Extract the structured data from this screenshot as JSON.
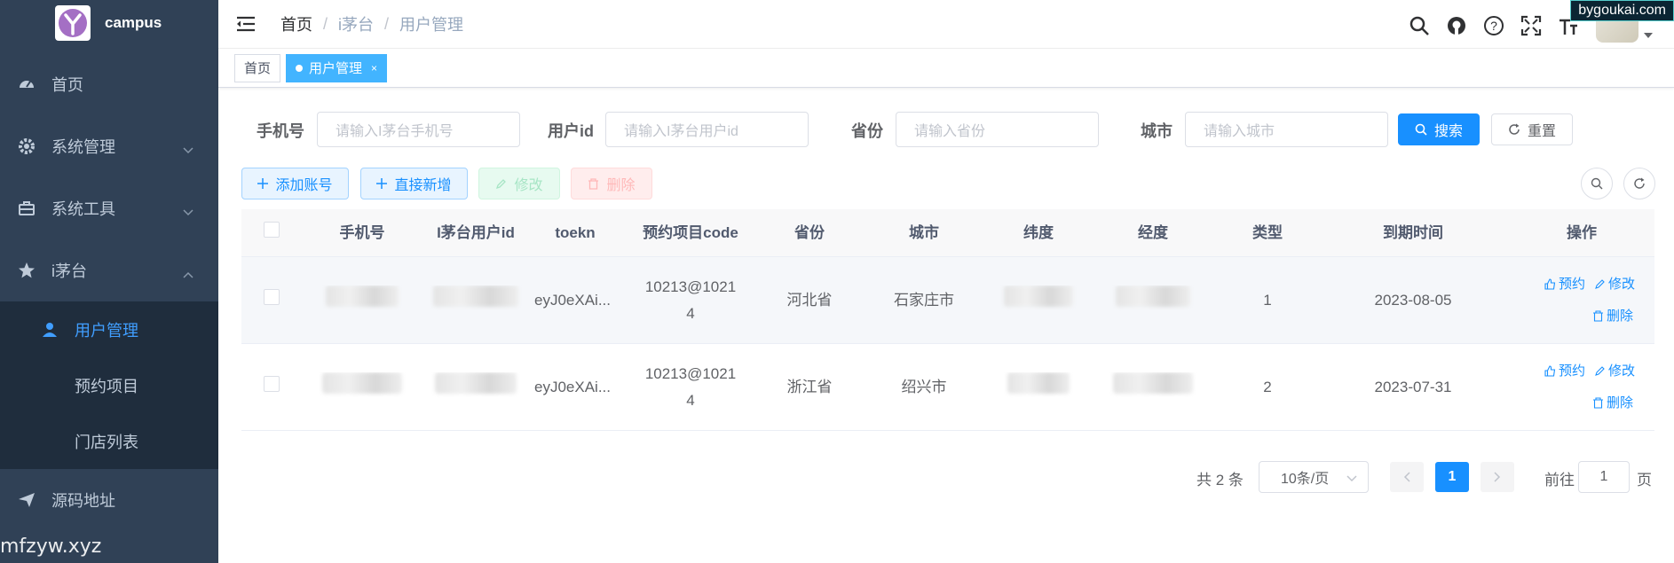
{
  "app": {
    "name": "campus"
  },
  "sidebar": {
    "items": [
      {
        "label": "首页",
        "icon": "dashboard-icon"
      },
      {
        "label": "系统管理",
        "icon": "gear-icon"
      },
      {
        "label": "系统工具",
        "icon": "toolbox-icon"
      },
      {
        "label": "i茅台",
        "icon": "star-icon"
      }
    ],
    "submenu": [
      {
        "label": "用户管理",
        "icon": "user-icon",
        "active": true
      },
      {
        "label": "预约项目"
      },
      {
        "label": "门店列表"
      }
    ],
    "bottom_item": {
      "label": "源码地址",
      "icon": "send-icon"
    }
  },
  "navbar": {
    "breadcrumb": [
      "首页",
      "i茅台",
      "用户管理"
    ],
    "watermark": "bygoukai.com"
  },
  "tags": [
    {
      "label": "首页",
      "active": false
    },
    {
      "label": "用户管理",
      "active": true,
      "close": "×"
    }
  ],
  "search": {
    "phone_label": "手机号",
    "phone_placeholder": "请输入I茅台手机号",
    "userid_label": "用户id",
    "userid_placeholder": "请输入I茅台用户id",
    "province_label": "省份",
    "province_placeholder": "请输入省份",
    "city_label": "城市",
    "city_placeholder": "请输入城市",
    "search_button": "搜索",
    "reset_button": "重置"
  },
  "toolbar": {
    "add_account": "添加账号",
    "direct_add": "直接新增",
    "edit": "修改",
    "delete": "删除"
  },
  "table": {
    "columns": [
      "手机号",
      "I茅台用户id",
      "toekn",
      "预约项目code",
      "省份",
      "城市",
      "纬度",
      "经度",
      "类型",
      "到期时间",
      "操作"
    ],
    "rows": [
      {
        "token": "eyJ0eXAi...",
        "code_l1": "10213@1021",
        "code_l2": "4",
        "province": "河北省",
        "city": "石家庄市",
        "type": "1",
        "expire": "2023-08-05"
      },
      {
        "token": "eyJ0eXAi...",
        "code_l1": "10213@1021",
        "code_l2": "4",
        "province": "浙江省",
        "city": "绍兴市",
        "type": "2",
        "expire": "2023-07-31"
      }
    ],
    "ops": {
      "reserve": "预约",
      "edit": "修改",
      "delete": "删除"
    }
  },
  "pagination": {
    "total": "共 2 条",
    "page_size": "10条/页",
    "current": "1",
    "goto": "前往",
    "goto_value": "1",
    "suffix": "页"
  },
  "footer_mark": "mfzyw.xyz"
}
